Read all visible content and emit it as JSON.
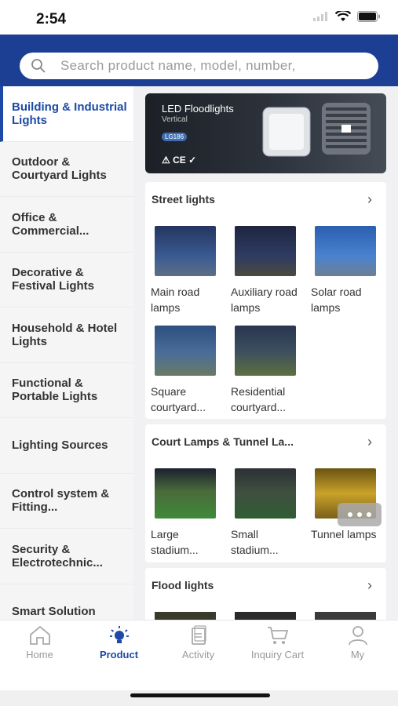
{
  "status": {
    "time": "2:54"
  },
  "search": {
    "placeholder": "Search product name, model, number,"
  },
  "sidebar": {
    "items": [
      {
        "label": "Building & Industrial Lights"
      },
      {
        "label": "Outdoor & Courtyard Lights"
      },
      {
        "label": "Office & Commercial..."
      },
      {
        "label": "Decorative & Festival Lights"
      },
      {
        "label": "Household & Hotel Lights"
      },
      {
        "label": "Functional & Portable Lights"
      },
      {
        "label": "Lighting Sources"
      },
      {
        "label": "Control system & Fitting..."
      },
      {
        "label": "Security & Electrotechnic..."
      },
      {
        "label": "Smart Solution"
      }
    ]
  },
  "banner": {
    "title": "LED Floodlights",
    "subtitle": "Vertical",
    "tag": "LG186",
    "marks": "⚠ CE ✓"
  },
  "sections": [
    {
      "title": "Street lights",
      "items": [
        {
          "label": "Main road lamps",
          "color": "#2f4c86"
        },
        {
          "label": "Auxiliary road lamps",
          "color": "#2a3559"
        },
        {
          "label": "Solar road lamps",
          "color": "#3d6fb7"
        },
        {
          "label": "Square courtyard...",
          "color": "#36577f"
        },
        {
          "label": "Residential courtyard...",
          "color": "#4a5346"
        }
      ]
    },
    {
      "title": "Court Lamps & Tunnel La...",
      "items": [
        {
          "label": "Large stadium...",
          "color": "#3f8a3a"
        },
        {
          "label": "Small stadium...",
          "color": "#2f5d33"
        },
        {
          "label": "Tunnel lamps",
          "color": "#c9a22a"
        }
      ]
    },
    {
      "title": "Flood lights",
      "items": []
    }
  ],
  "tabs": [
    {
      "label": "Home"
    },
    {
      "label": "Product"
    },
    {
      "label": "Activity"
    },
    {
      "label": "Inquiry Cart"
    },
    {
      "label": "My"
    }
  ],
  "colors": {
    "primary": "#1c3f94",
    "active_text": "#1c4aa6"
  }
}
